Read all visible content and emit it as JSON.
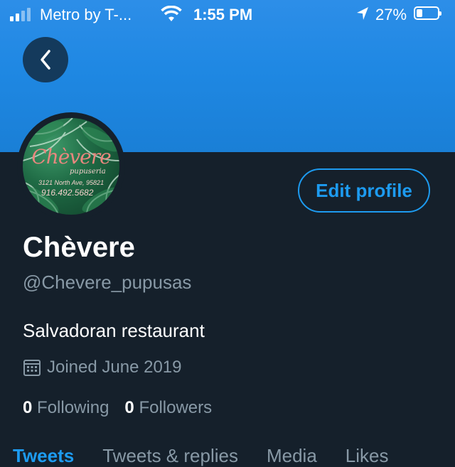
{
  "status_bar": {
    "carrier": "Metro by T-...",
    "time": "1:55 PM",
    "battery": "27%",
    "battery_level": 0.27
  },
  "avatar_logo": {
    "name": "Chèvere",
    "sub": "pupuseria",
    "address": "3121 North Ave, 95821",
    "phone": "916.492.5682"
  },
  "buttons": {
    "edit_profile": "Edit profile"
  },
  "profile": {
    "display_name": "Chèvere",
    "handle": "@Chevere_pupusas",
    "bio": "Salvadoran restaurant",
    "joined": "Joined June 2019",
    "following_count": "0",
    "following_label": "Following",
    "followers_count": "0",
    "followers_label": "Followers"
  },
  "tabs": [
    "Tweets",
    "Tweets & replies",
    "Media",
    "Likes"
  ],
  "colors": {
    "accent": "#1d9bf0",
    "background": "#15202b",
    "muted": "#8899a6",
    "banner": "#1f88e3"
  },
  "icons": [
    "signal-icon",
    "wifi-icon",
    "location-arrow-icon",
    "battery-icon",
    "back-arrow-icon",
    "calendar-icon"
  ]
}
